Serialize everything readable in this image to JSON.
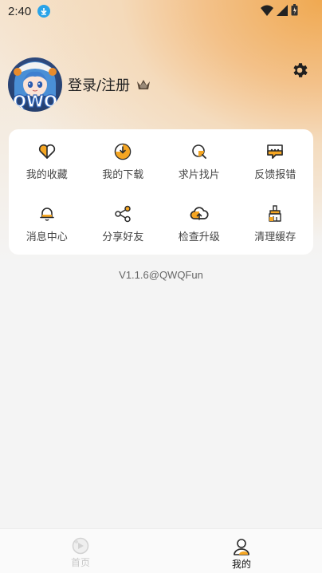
{
  "status_bar": {
    "time": "2:40",
    "icons": [
      "download-notification-icon",
      "wifi-icon",
      "signal-icon",
      "battery-icon"
    ]
  },
  "profile": {
    "avatar_text": "QWQ",
    "login_label": "登录/注册",
    "icons": [
      "crown-icon",
      "gear-icon"
    ]
  },
  "menu": {
    "items": [
      {
        "label": "我的收藏",
        "icon": "heart-icon"
      },
      {
        "label": "我的下载",
        "icon": "download-icon"
      },
      {
        "label": "求片找片",
        "icon": "search-film-icon"
      },
      {
        "label": "反馈报错",
        "icon": "feedback-icon"
      },
      {
        "label": "消息中心",
        "icon": "bell-icon"
      },
      {
        "label": "分享好友",
        "icon": "share-icon"
      },
      {
        "label": "检查升级",
        "icon": "cloud-upload-icon"
      },
      {
        "label": "清理缓存",
        "icon": "clean-icon"
      }
    ]
  },
  "version": "V1.1.6@QWQFun",
  "bottom_nav": {
    "tabs": [
      {
        "label": "首页",
        "icon": "home-icon",
        "active": false
      },
      {
        "label": "我的",
        "icon": "mine-icon",
        "active": true
      }
    ]
  },
  "colors": {
    "accent": "#f5a623",
    "accent_dark": "#3a2a10",
    "header_gradient": "#f0a951",
    "background": "#f4f4f4"
  }
}
